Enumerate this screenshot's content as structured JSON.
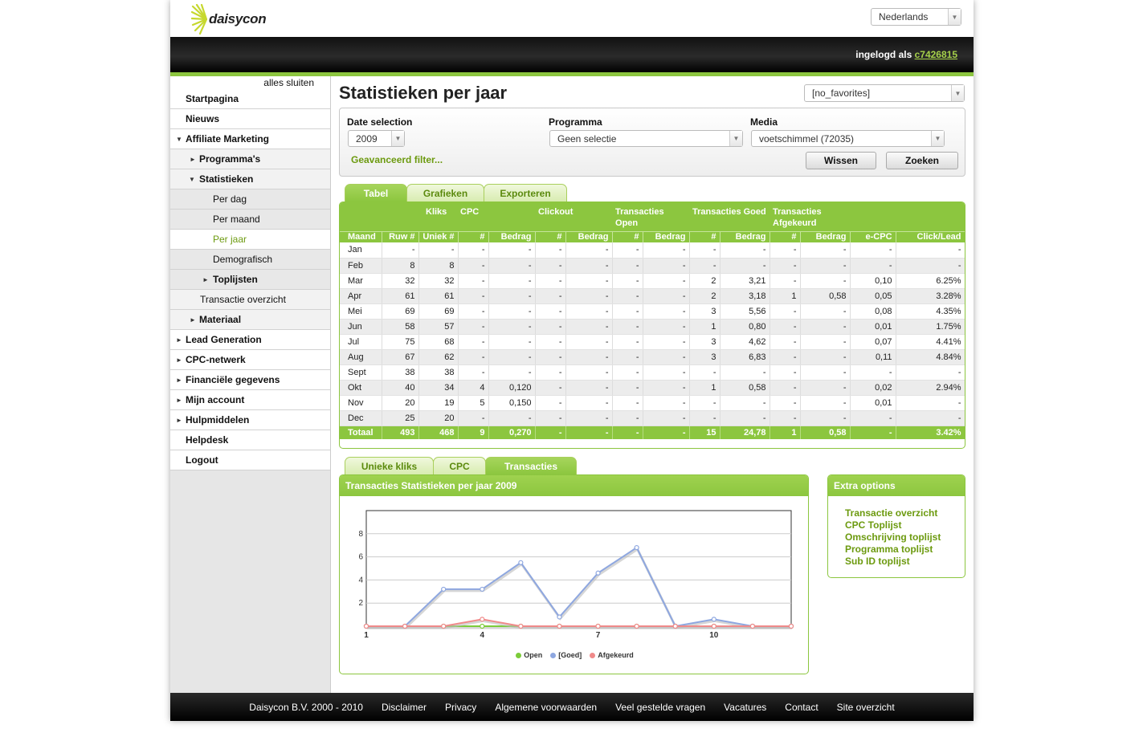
{
  "brand": {
    "name": "daisycon",
    "accent": "#8cc63f",
    "link_green": "#6c9a0f"
  },
  "header": {
    "language": "Nederlands",
    "login_prefix": "ingelogd als",
    "login_user": "c7426815"
  },
  "sidebar": {
    "close_all": "alles sluiten",
    "items": [
      {
        "label": "Startpagina"
      },
      {
        "label": "Nieuws"
      },
      {
        "label": "Affiliate Marketing"
      },
      {
        "label": "Programma's"
      },
      {
        "label": "Statistieken"
      },
      {
        "label": "Per dag"
      },
      {
        "label": "Per maand"
      },
      {
        "label": "Per jaar"
      },
      {
        "label": "Demografisch"
      },
      {
        "label": "Toplijsten"
      },
      {
        "label": "Transactie overzicht"
      },
      {
        "label": "Materiaal"
      },
      {
        "label": "Lead Generation"
      },
      {
        "label": "CPC-netwerk"
      },
      {
        "label": "Financiële gegevens"
      },
      {
        "label": "Mijn account"
      },
      {
        "label": "Hulpmiddelen"
      },
      {
        "label": "Helpdesk"
      },
      {
        "label": "Logout"
      }
    ]
  },
  "main": {
    "title": "Statistieken per jaar",
    "favorites": "[no_favorites]",
    "filter": {
      "date_label": "Date selection",
      "date_value": "2009",
      "program_label": "Programma",
      "program_value": "Geen selectie",
      "media_label": "Media",
      "media_value": "voetschimmel (72035)",
      "advanced": "Geavanceerd filter...",
      "clear": "Wissen",
      "search": "Zoeken"
    },
    "tabs": [
      "Tabel",
      "Grafieken",
      "Exporteren"
    ],
    "table": {
      "groups": [
        "Kliks",
        "CPC",
        "Clickout",
        "Transacties Open",
        "Transacties Goed",
        "Transacties Afgekeurd"
      ],
      "columns": [
        "Maand",
        "Ruw #",
        "Uniek #",
        "#",
        "Bedrag",
        "#",
        "Bedrag",
        "#",
        "Bedrag",
        "#",
        "Bedrag",
        "#",
        "Bedrag",
        "e-CPC",
        "Click/Lead"
      ],
      "rows": [
        [
          "Jan",
          "-",
          "-",
          "-",
          "-",
          "-",
          "-",
          "-",
          "-",
          "-",
          "-",
          "-",
          "-",
          "-",
          "-"
        ],
        [
          "Feb",
          "8",
          "8",
          "-",
          "-",
          "-",
          "-",
          "-",
          "-",
          "-",
          "-",
          "-",
          "-",
          "-",
          "-"
        ],
        [
          "Mar",
          "32",
          "32",
          "-",
          "-",
          "-",
          "-",
          "-",
          "-",
          "2",
          "3,21",
          "-",
          "-",
          "0,10",
          "6.25%"
        ],
        [
          "Apr",
          "61",
          "61",
          "-",
          "-",
          "-",
          "-",
          "-",
          "-",
          "2",
          "3,18",
          "1",
          "0,58",
          "0,05",
          "3.28%"
        ],
        [
          "Mei",
          "69",
          "69",
          "-",
          "-",
          "-",
          "-",
          "-",
          "-",
          "3",
          "5,56",
          "-",
          "-",
          "0,08",
          "4.35%"
        ],
        [
          "Jun",
          "58",
          "57",
          "-",
          "-",
          "-",
          "-",
          "-",
          "-",
          "1",
          "0,80",
          "-",
          "-",
          "0,01",
          "1.75%"
        ],
        [
          "Jul",
          "75",
          "68",
          "-",
          "-",
          "-",
          "-",
          "-",
          "-",
          "3",
          "4,62",
          "-",
          "-",
          "0,07",
          "4.41%"
        ],
        [
          "Aug",
          "67",
          "62",
          "-",
          "-",
          "-",
          "-",
          "-",
          "-",
          "3",
          "6,83",
          "-",
          "-",
          "0,11",
          "4.84%"
        ],
        [
          "Sept",
          "38",
          "38",
          "-",
          "-",
          "-",
          "-",
          "-",
          "-",
          "-",
          "-",
          "-",
          "-",
          "-",
          "-"
        ],
        [
          "Okt",
          "40",
          "34",
          "4",
          "0,120",
          "-",
          "-",
          "-",
          "-",
          "1",
          "0,58",
          "-",
          "-",
          "0,02",
          "2.94%"
        ],
        [
          "Nov",
          "20",
          "19",
          "5",
          "0,150",
          "-",
          "-",
          "-",
          "-",
          "-",
          "-",
          "-",
          "-",
          "0,01",
          "-"
        ],
        [
          "Dec",
          "25",
          "20",
          "-",
          "-",
          "-",
          "-",
          "-",
          "-",
          "-",
          "-",
          "-",
          "-",
          "-",
          "-"
        ]
      ],
      "total": [
        "Totaal",
        "493",
        "468",
        "9",
        "0,270",
        "-",
        "-",
        "-",
        "-",
        "15",
        "24,78",
        "1",
        "0,58",
        "-",
        "3.42%"
      ]
    },
    "chart_tabs": [
      "Unieke kliks",
      "CPC",
      "Transacties"
    ],
    "chart_title": "Transacties Statistieken per jaar 2009",
    "extra": {
      "title": "Extra options",
      "links": [
        "Transactie overzicht",
        "CPC Toplijst",
        "Omschrijving toplijst",
        "Programma toplijst",
        "Sub ID toplijst"
      ]
    }
  },
  "chart_data": {
    "type": "line",
    "x": [
      1,
      2,
      3,
      4,
      5,
      6,
      7,
      8,
      9,
      10,
      11,
      12
    ],
    "xticks": [
      1,
      4,
      7,
      10
    ],
    "yticks": [
      2,
      4,
      6,
      8
    ],
    "ylim": [
      0,
      10
    ],
    "series": [
      {
        "name": "Open",
        "color": "#7ccc3a",
        "values": [
          0,
          0,
          0,
          0,
          0,
          0,
          0,
          0,
          0,
          0,
          0,
          0
        ]
      },
      {
        "name": "[Goed]",
        "color": "#8ea7e0",
        "values": [
          0,
          0,
          3.2,
          3.2,
          5.5,
          0.8,
          4.6,
          6.8,
          0,
          0.6,
          0,
          0
        ]
      },
      {
        "name": "Afgekeurd",
        "color": "#f08a8a",
        "values": [
          0,
          0,
          0,
          0.6,
          0,
          0,
          0,
          0,
          0,
          0,
          0,
          0
        ]
      }
    ]
  },
  "footer": {
    "links": [
      "Daisycon B.V. 2000 - 2010",
      "Disclaimer",
      "Privacy",
      "Algemene voorwaarden",
      "Veel gestelde vragen",
      "Vacatures",
      "Contact",
      "Site overzicht"
    ]
  }
}
